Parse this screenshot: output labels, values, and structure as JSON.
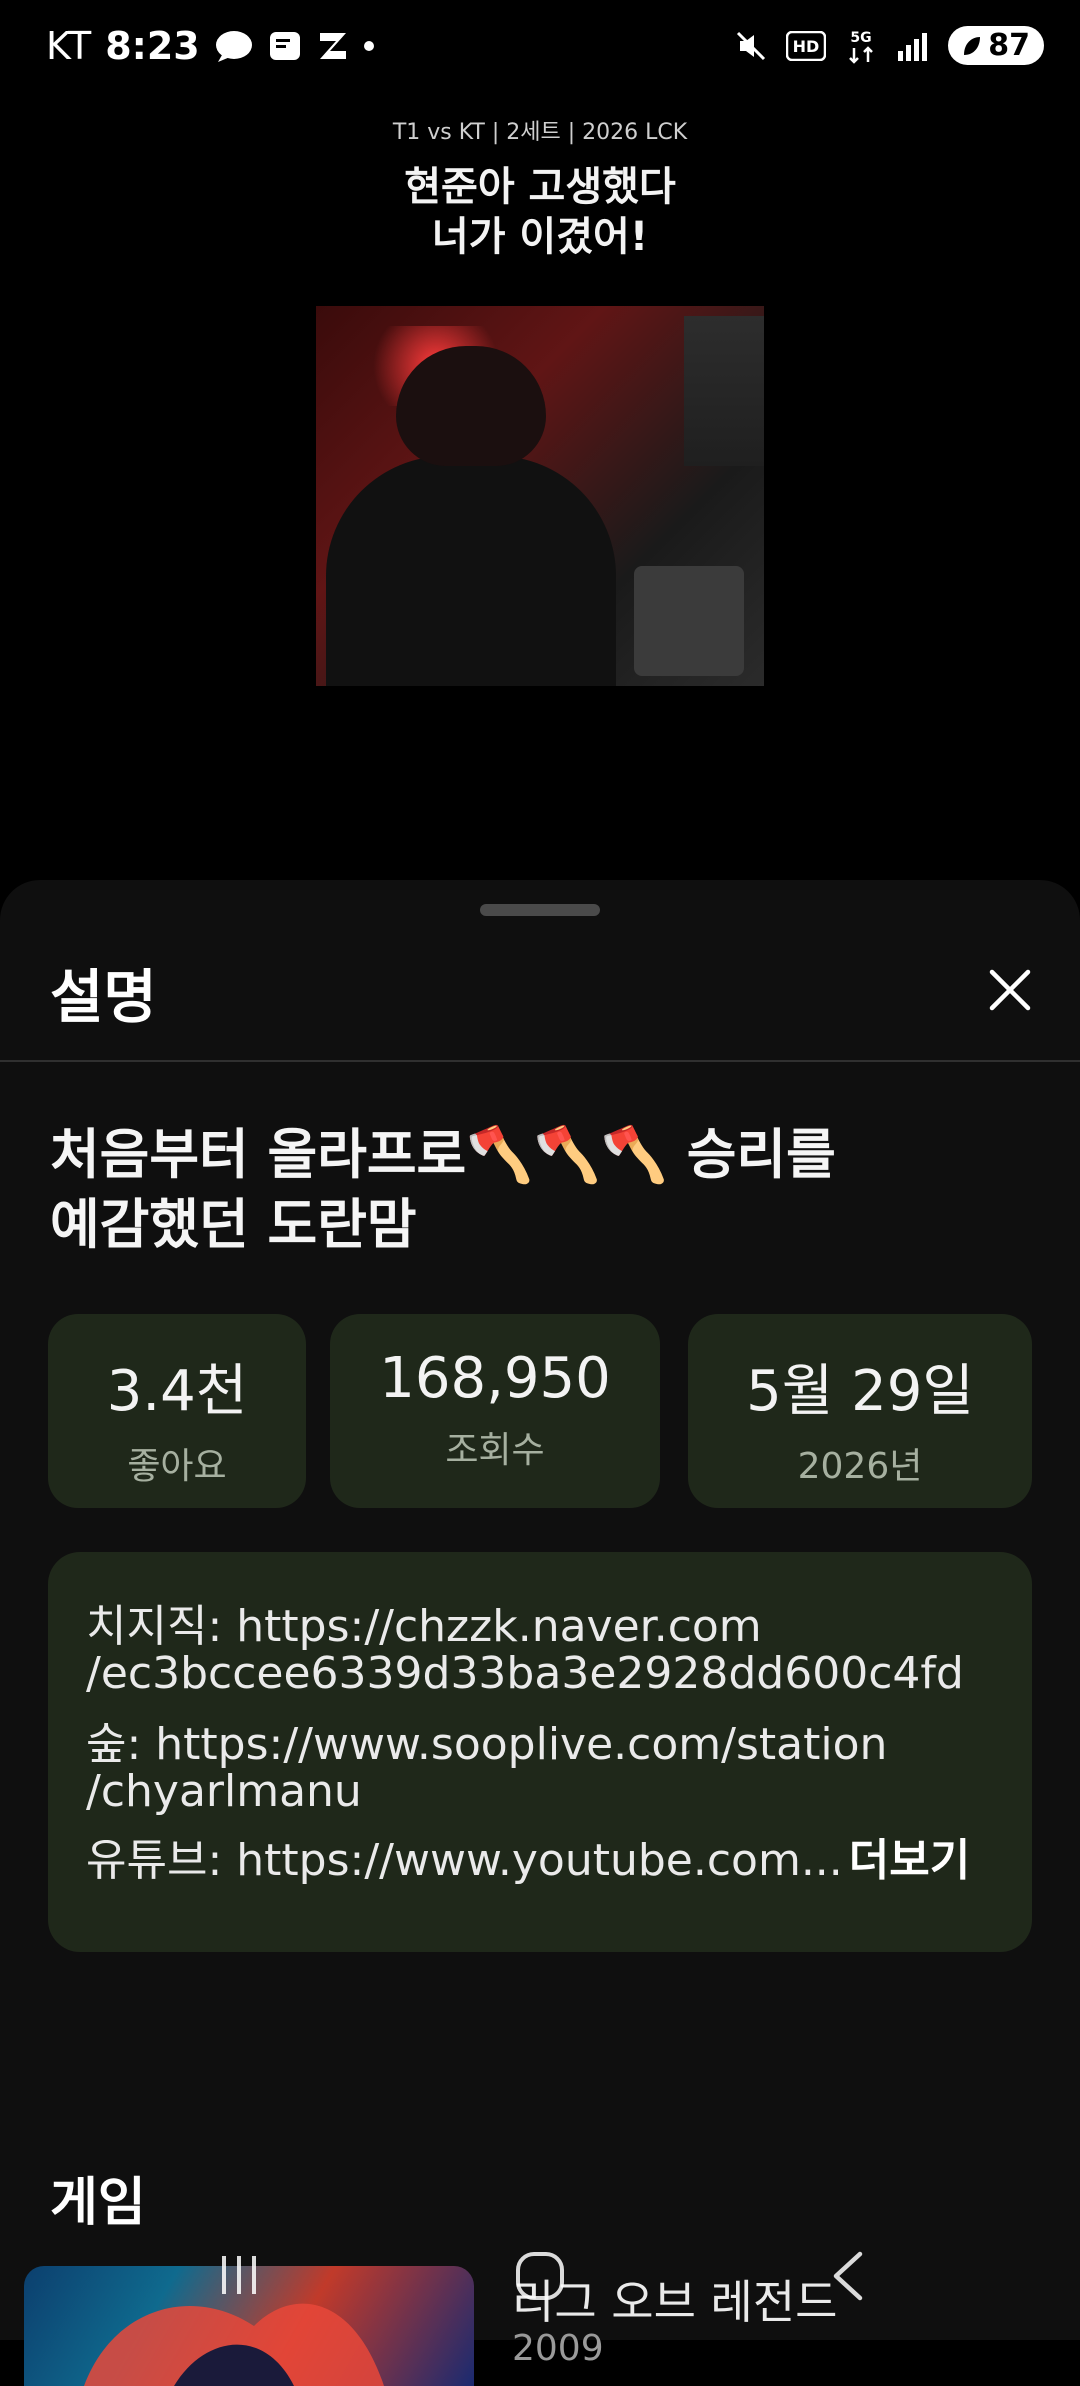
{
  "status_bar": {
    "carrier": "KT",
    "time": "8:23",
    "battery": "87"
  },
  "video": {
    "caption": "T1 vs KT | 2세트 | 2026 LCK",
    "headline_line1": "현준아 고생했다",
    "headline_line2": "너가 이겼어!"
  },
  "sheet": {
    "title": "설명",
    "video_title_line1": "처음부터 올라프로🪓🪓🪓 승리를",
    "video_title_line2": "예감했던 도란맘",
    "stats": [
      {
        "value": "3.4천",
        "label": "좋아요"
      },
      {
        "value": "168,950",
        "label": "조회수"
      },
      {
        "value": "5월 29일",
        "label": "2026년"
      }
    ],
    "description_lines": [
      "치지직: https://chzzk.naver.com",
      "/ec3bccee6339d33ba3e2928dd600c4fd",
      "숲: https://www.sooplive.com/station",
      "/chyarlmanu",
      "유튜브: https://www.youtube.com..."
    ],
    "more_label": "더보기",
    "section_game": "게임",
    "game_title": "리그 오브 레전드",
    "game_year": "2009"
  },
  "colors": {
    "card_bg": "#1f281a",
    "sheet_bg": "#0f0f0f"
  }
}
